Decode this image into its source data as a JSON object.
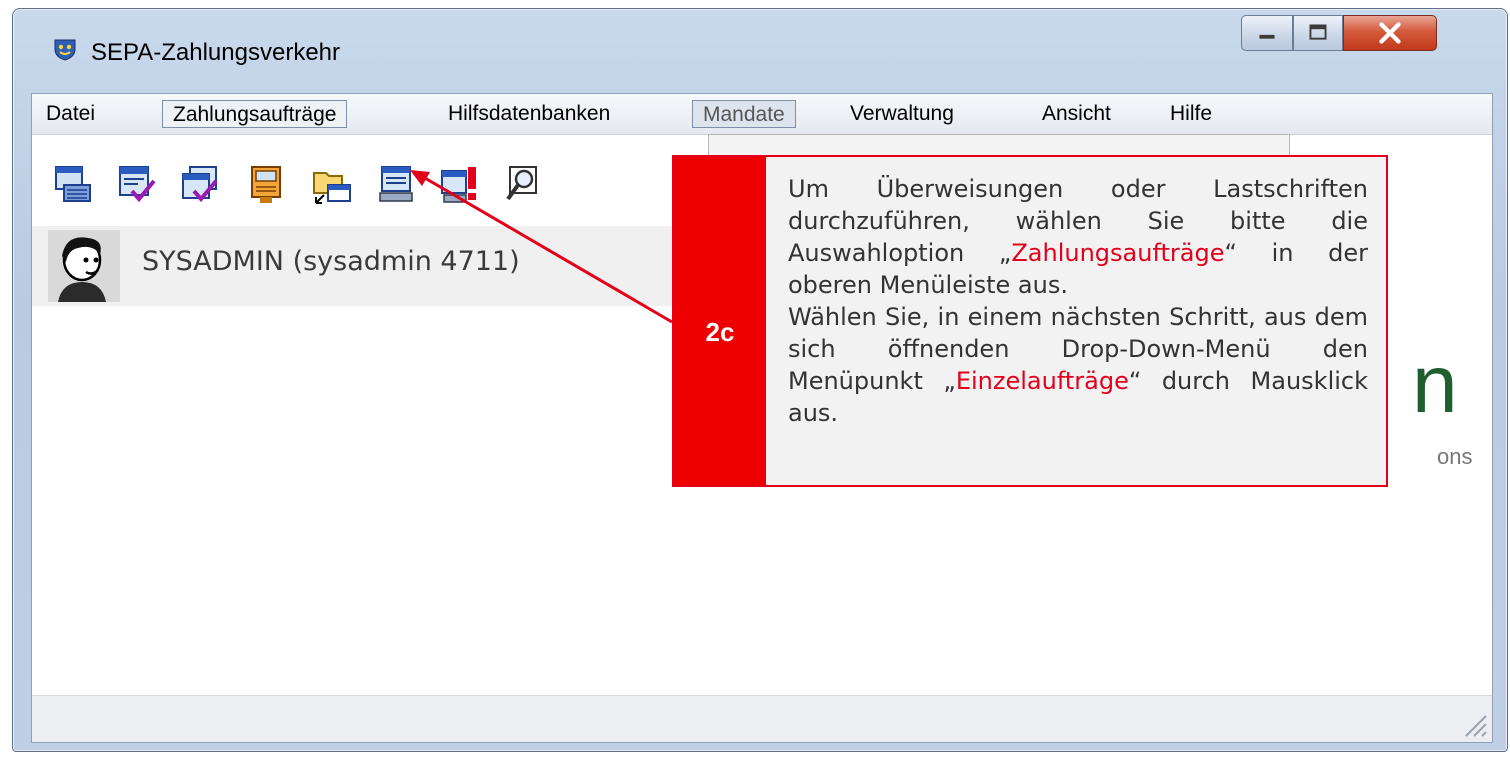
{
  "window": {
    "title": "SEPA-Zahlungsverkehr",
    "controls": [
      "minimize",
      "maximize",
      "close"
    ]
  },
  "menu": [
    {
      "label": "Datei"
    },
    {
      "label": "Zahlungsaufträge"
    },
    {
      "label": "Hilfsdatenbanken"
    },
    {
      "label": "Mandate"
    },
    {
      "label": "Verwaltung"
    },
    {
      "label": "Ansicht"
    },
    {
      "label": "Hilfe"
    }
  ],
  "toolbar": {
    "icons": [
      "keyboard-form-icon",
      "form-check-icon",
      "forms-check-icon",
      "archive-box-icon",
      "folder-transfer-icon",
      "computer-form-icon",
      "computer-alert-icon",
      "magnifier-doc-icon"
    ]
  },
  "user": {
    "label": "SYSADMIN (sysadmin 4711)"
  },
  "branding": {
    "letter": "n",
    "sub": "ons"
  },
  "callout": {
    "step": "2c",
    "p1_a": "Um Überweisungen oder Lastschriften durchzuführen, wählen Sie bitte die Auswahloption „",
    "p1_hl": "Zahlungsaufträge",
    "p1_b": "“ in der oberen Menüleiste aus.",
    "p2_a": "Wählen Sie, in einem nächsten Schritt, aus dem sich öffnenden Drop-Down-Menü den Menüpunkt „",
    "p2_hl": "Einzelaufträge",
    "p2_b": "“ durch Mausklick aus."
  },
  "colors": {
    "accent_red": "#e2001a",
    "brand_green": "#1f5f2f"
  }
}
